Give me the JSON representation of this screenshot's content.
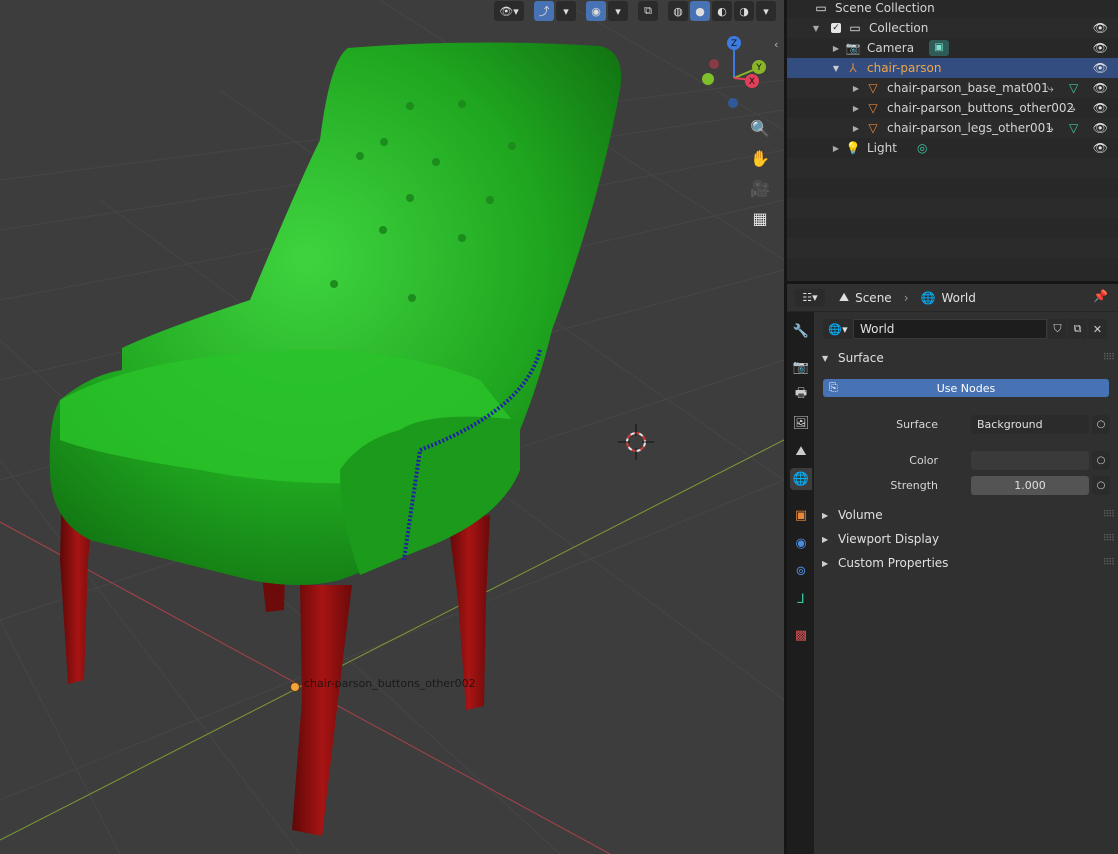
{
  "viewport": {
    "header_icons": [
      "view-object-types-icon",
      "gizmo-icon",
      "overlay-icon",
      "xray-icon",
      "wireframe-shading-icon",
      "solid-shading-icon",
      "material-shading-icon",
      "rendered-shading-icon"
    ],
    "gizmo_axes": {
      "z": "Z",
      "y": "Y",
      "x": "X"
    },
    "object_label": "chair-parson_buttons_other002",
    "colors": {
      "background": "#3d3d3d",
      "grid": "#444444",
      "x_axis": "#a8424a",
      "y_axis": "#7f9a35",
      "chair_green": "#1fa51f",
      "legs_red": "#8a0e0e",
      "buttons_blue": "#2a2ab0"
    }
  },
  "outliner": {
    "root": "Scene Collection",
    "rows": [
      {
        "label": "Collection",
        "icon": "collection-icon"
      },
      {
        "label": "Camera",
        "icon": "camera-icon"
      },
      {
        "label": "chair-parson",
        "icon": "empty-icon"
      },
      {
        "label": "chair-parson_base_mat001",
        "icon": "mesh-icon"
      },
      {
        "label": "chair-parson_buttons_other002",
        "icon": "mesh-icon"
      },
      {
        "label": "chair-parson_legs_other001",
        "icon": "mesh-icon"
      },
      {
        "label": "Light",
        "icon": "light-icon"
      }
    ]
  },
  "properties": {
    "breadcrumb": {
      "scene": "Scene",
      "world": "World"
    },
    "world_name": "World",
    "surface_section": "Surface",
    "use_nodes": "Use Nodes",
    "surface_label": "Surface",
    "surface_value": "Background",
    "color_label": "Color",
    "strength_label": "Strength",
    "strength_value": "1.000",
    "sections": [
      "Volume",
      "Viewport Display",
      "Custom Properties"
    ]
  }
}
